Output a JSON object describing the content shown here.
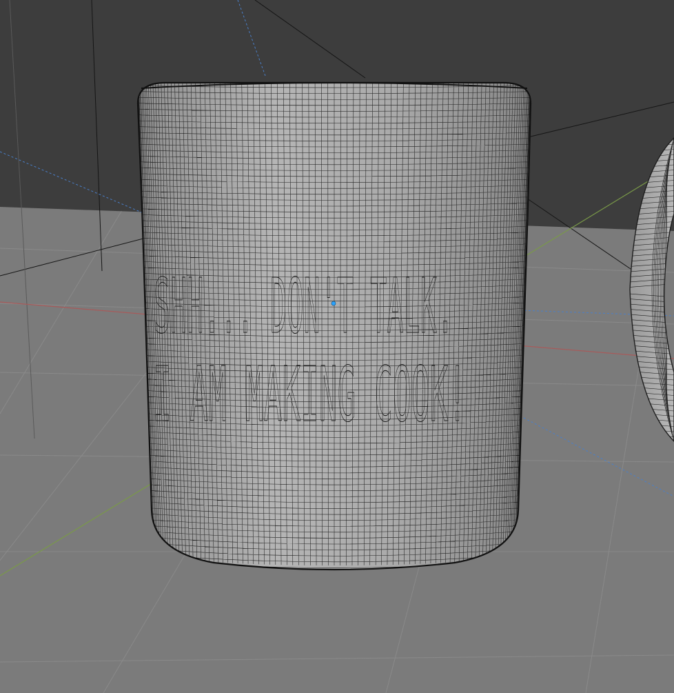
{
  "viewport": {
    "name": "3d-viewport",
    "mode": "wireframe-overlay"
  },
  "mug": {
    "engraving": {
      "line1": "SHH... DON'T TALK.",
      "line2": "I AM MAKING COOK!"
    }
  },
  "colors": {
    "sky": "#3d3d3d",
    "floor": "#7b7b7b",
    "floor_grid": "#8a8a8a",
    "axis_x": "#a85a5a",
    "axis_y": "#7a9a48",
    "mug_body": "#a6a6a6",
    "wire": "#1e1e1e",
    "guide_blue": "#4a7fc9",
    "origin_dot": "#2aa3ff"
  }
}
